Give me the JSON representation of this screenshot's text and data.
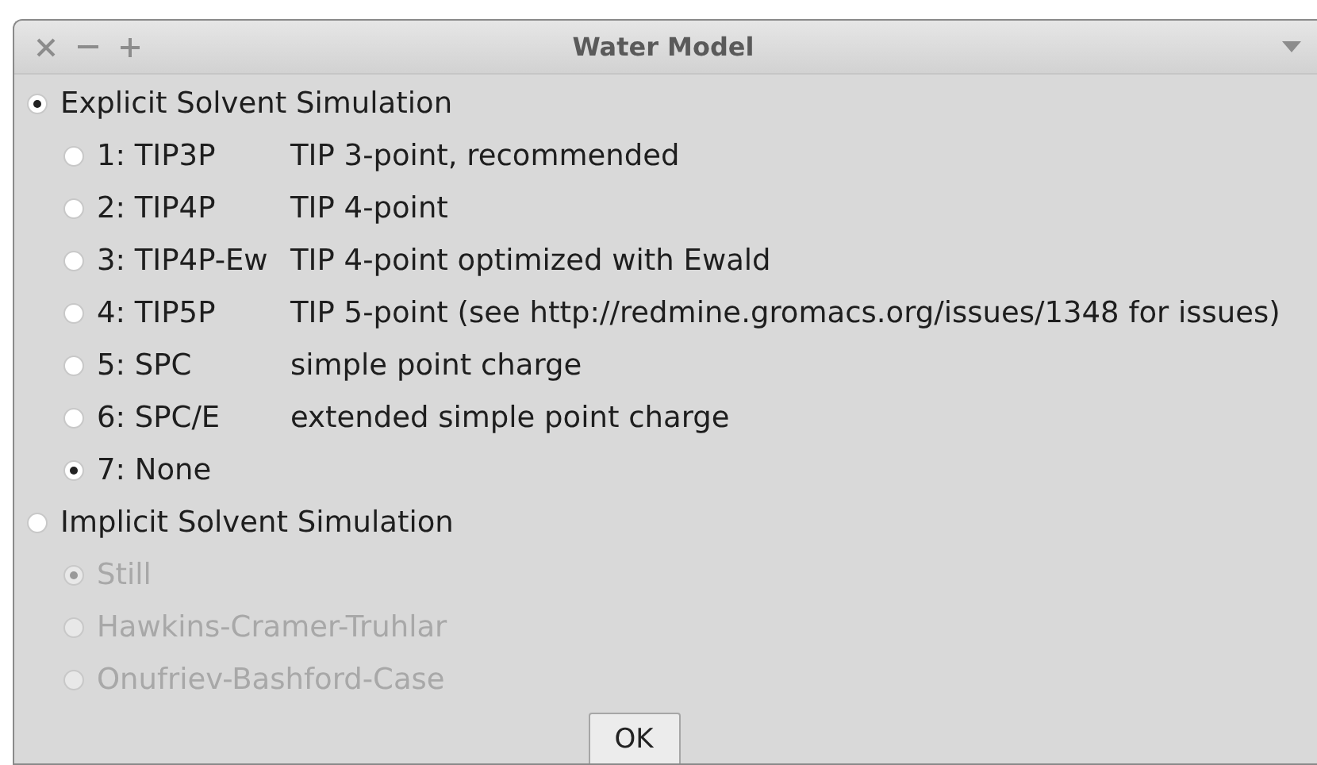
{
  "window": {
    "title": "Water Model"
  },
  "groups": [
    {
      "label": "Explicit Solvent Simulation",
      "selected": true,
      "options": [
        {
          "code": "1: TIP3P",
          "description": "TIP 3-point, recommended",
          "selected": false,
          "disabled": false
        },
        {
          "code": "2: TIP4P",
          "description": "TIP 4-point",
          "selected": false,
          "disabled": false
        },
        {
          "code": "3: TIP4P-Ew",
          "description": "TIP 4-point optimized with Ewald",
          "selected": false,
          "disabled": false
        },
        {
          "code": "4: TIP5P",
          "description": "TIP 5-point (see http://redmine.gromacs.org/issues/1348 for issues)",
          "selected": false,
          "disabled": false
        },
        {
          "code": "5: SPC",
          "description": "simple point charge",
          "selected": false,
          "disabled": false
        },
        {
          "code": "6: SPC/E",
          "description": "extended simple point charge",
          "selected": false,
          "disabled": false
        },
        {
          "code": "7: None",
          "selected": true,
          "disabled": false
        }
      ]
    },
    {
      "label": "Implicit Solvent Simulation",
      "selected": false,
      "options": [
        {
          "code": "Still",
          "selected": true,
          "disabled": true
        },
        {
          "code": "Hawkins-Cramer-Truhlar",
          "selected": false,
          "disabled": true
        },
        {
          "code": "Onufriev-Bashford-Case",
          "selected": false,
          "disabled": true
        }
      ]
    }
  ],
  "ok_button": "OK"
}
